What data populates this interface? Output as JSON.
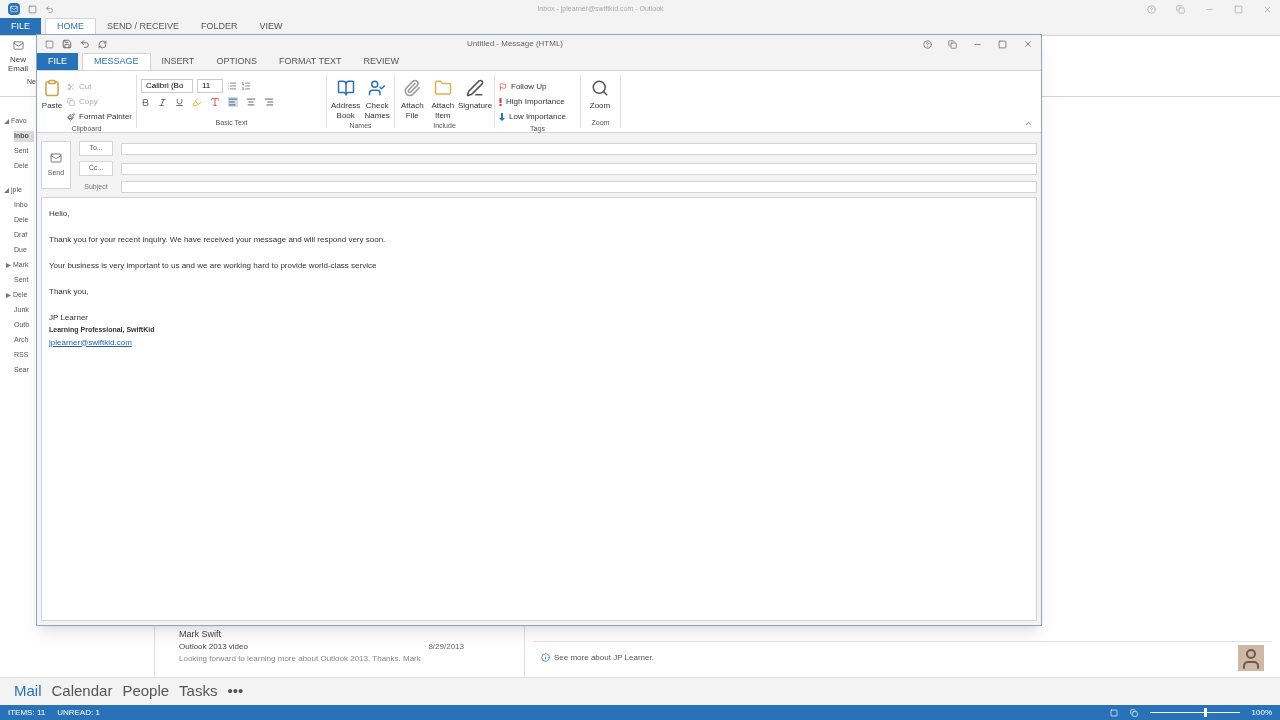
{
  "main_window": {
    "title": "Inbox - jplearner@swiftkid.com - Outlook",
    "tabs": [
      {
        "label": "FILE",
        "kind": "file",
        "selected": false
      },
      {
        "label": "HOME",
        "kind": "tab",
        "selected": true
      },
      {
        "label": "SEND / RECEIVE",
        "kind": "tab",
        "selected": false
      },
      {
        "label": "FOLDER",
        "kind": "tab",
        "selected": false
      },
      {
        "label": "VIEW",
        "kind": "tab",
        "selected": false
      }
    ],
    "new_email": {
      "line_1": "New",
      "line_2": "Email",
      "group": "Ne"
    },
    "folders": [
      {
        "label": "Favo",
        "kind": "header"
      },
      {
        "label": "Inbo",
        "kind": "item",
        "selected": true
      },
      {
        "label": "Sent",
        "kind": "item",
        "selected": false
      },
      {
        "label": "Dele",
        "kind": "item",
        "selected": false
      },
      {
        "label": "jple",
        "kind": "header"
      },
      {
        "label": "Inbo",
        "kind": "item",
        "selected": false
      },
      {
        "label": "Dele",
        "kind": "item",
        "selected": false
      },
      {
        "label": "Draf",
        "kind": "item",
        "selected": false
      },
      {
        "label": "Due",
        "kind": "item",
        "selected": false
      },
      {
        "label": "Mark",
        "kind": "collapsed",
        "selected": false
      },
      {
        "label": "Sent",
        "kind": "item",
        "selected": false
      },
      {
        "label": "Dele",
        "kind": "collapsed",
        "selected": false
      },
      {
        "label": "Junk",
        "kind": "item",
        "selected": false
      },
      {
        "label": "Outb",
        "kind": "item",
        "selected": false
      },
      {
        "label": "Arch",
        "kind": "item",
        "selected": false
      },
      {
        "label": "RSS",
        "kind": "item",
        "selected": false
      },
      {
        "label": "Sear",
        "kind": "item",
        "selected": false
      }
    ],
    "message_list": [
      {
        "sender": "Mark Swift",
        "subject": "Outlook 2013 video",
        "date": "8/29/2013",
        "preview": "Looking forward to learning more about Outlook 2013. Thanks. Mark"
      }
    ],
    "people_pane": {
      "text": "See more about JP Learner."
    },
    "navigation": [
      {
        "label": "Mail",
        "selected": true
      },
      {
        "label": "Calendar",
        "selected": false
      },
      {
        "label": "People",
        "selected": false
      },
      {
        "label": "Tasks",
        "selected": false
      },
      {
        "label": "•••",
        "selected": false
      }
    ],
    "status_bar": {
      "items": "ITEMS: 11",
      "unread": "UNREAD: 1",
      "zoom": "100%",
      "level": 0.6
    }
  },
  "message_window": {
    "title": "Untitled - Message (HTML)",
    "tabs": [
      {
        "label": "FILE",
        "kind": "file",
        "selected": false
      },
      {
        "label": "MESSAGE",
        "kind": "tab",
        "selected": true
      },
      {
        "label": "INSERT",
        "kind": "tab",
        "selected": false
      },
      {
        "label": "OPTIONS",
        "kind": "tab",
        "selected": false
      },
      {
        "label": "FORMAT TEXT",
        "kind": "tab",
        "selected": false
      },
      {
        "label": "REVIEW",
        "kind": "tab",
        "selected": false
      }
    ],
    "ribbon": {
      "clipboard": {
        "paste": "Paste",
        "cut": "Cut",
        "copy": "Copy",
        "format_painter": "Format Painter",
        "label": "Clipboard"
      },
      "basic_text": {
        "font": "Calibri (Bo",
        "size": "11",
        "label": "Basic Text"
      },
      "names": {
        "buttons": [
          "Address Book",
          "Check Names"
        ],
        "label": "Names"
      },
      "include": {
        "buttons": [
          "Attach File",
          "Attach Item",
          "Signature"
        ],
        "label": "Include"
      },
      "tags": {
        "buttons": [
          "Follow Up",
          "High Importance",
          "Low Importance"
        ],
        "label": "Tags"
      },
      "zoom": {
        "button": "Zoom",
        "label": "Zoom"
      }
    },
    "send": "Send",
    "fields": [
      {
        "label": "To...",
        "kind": "button"
      },
      {
        "label": "Cc...",
        "kind": "button"
      },
      {
        "label": "Subject",
        "kind": "text"
      }
    ],
    "body": [
      {
        "text": "Hello,",
        "kind": "para"
      },
      {
        "text": "Thank you for your recent inquiry. We have received your message and will respond very soon.",
        "kind": "para"
      },
      {
        "text": "Your business is very important to us and we are working hard to provide world-class service",
        "kind": "para"
      },
      {
        "text": "Thank you,",
        "kind": "para"
      },
      {
        "text": "JP Learner",
        "kind": "line"
      },
      {
        "text": "Learning Professional, SwiftKid",
        "kind": "bold"
      },
      {
        "text": "jplearner@swiftkid.com",
        "kind": "link"
      }
    ]
  }
}
